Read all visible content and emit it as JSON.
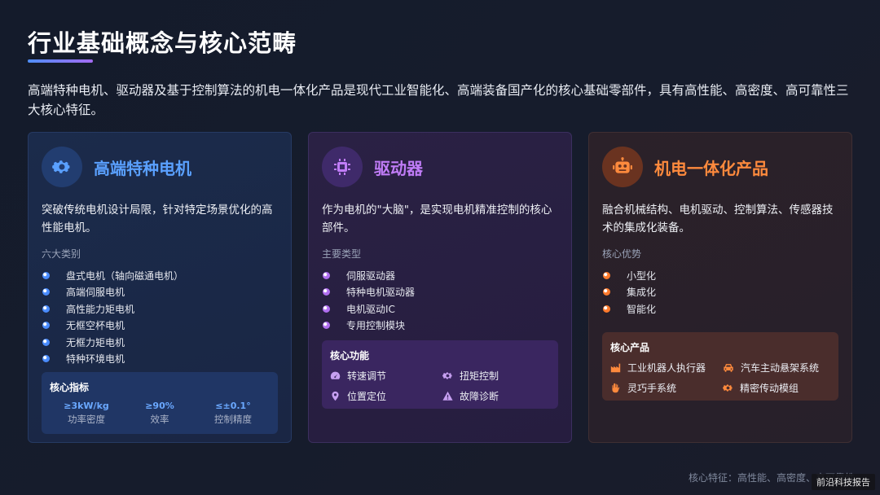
{
  "title": "行业基础概念与核心范畴",
  "intro": "高端特种电机、驱动器及基于控制算法的机电一体化产品是现代工业智能化、高端装备国产化的核心基础零部件，具有高性能、高密度、高可靠性三大核心特征。",
  "cards": [
    {
      "title": "高端特种电机",
      "icon": "gear-icon",
      "desc": "突破传统电机设计局限，针对特定场景优化的高性能电机。",
      "section": "六大类别",
      "items": [
        "盘式电机（轴向磁通电机）",
        "高端伺服电机",
        "高性能力矩电机",
        "无框空杯电机",
        "无框力矩电机",
        "特种环境电机"
      ],
      "panel": {
        "title": "核心指标",
        "metrics": [
          {
            "value": "≥3kW/kg",
            "label": "功率密度"
          },
          {
            "value": "≥90%",
            "label": "效率"
          },
          {
            "value": "≤±0.1°",
            "label": "控制精度"
          }
        ]
      }
    },
    {
      "title": "驱动器",
      "icon": "chip-icon",
      "desc": "作为电机的\"大脑\"，是实现电机精准控制的核心部件。",
      "section": "主要类型",
      "items": [
        "伺服驱动器",
        "特种电机驱动器",
        "电机驱动IC",
        "专用控制模块"
      ],
      "panel": {
        "title": "核心功能",
        "features": [
          {
            "label": "转速调节",
            "icon": "speedometer-icon"
          },
          {
            "label": "扭矩控制",
            "icon": "cog-icon"
          },
          {
            "label": "位置定位",
            "icon": "location-pin-icon"
          },
          {
            "label": "故障诊断",
            "icon": "warning-icon"
          }
        ]
      }
    },
    {
      "title": "机电一体化产品",
      "icon": "robot-icon",
      "desc": "融合机械结构、电机驱动、控制算法、传感器技术的集成化装备。",
      "section": "核心优势",
      "items": [
        "小型化",
        "集成化",
        "智能化"
      ],
      "panel": {
        "title": "核心产品",
        "features": [
          {
            "label": "工业机器人执行器",
            "icon": "factory-icon"
          },
          {
            "label": "汽车主动悬架系统",
            "icon": "car-icon"
          },
          {
            "label": "灵巧手系统",
            "icon": "hand-icon"
          },
          {
            "label": "精密传动模组",
            "icon": "cog-icon"
          }
        ]
      }
    }
  ],
  "footer": "核心特征：高性能、高密度、高可靠性",
  "watermark": "前沿科技报告",
  "colors": {
    "blue": "#5aa0ff",
    "purple": "#c07cf7",
    "orange": "#ff8a3d"
  }
}
